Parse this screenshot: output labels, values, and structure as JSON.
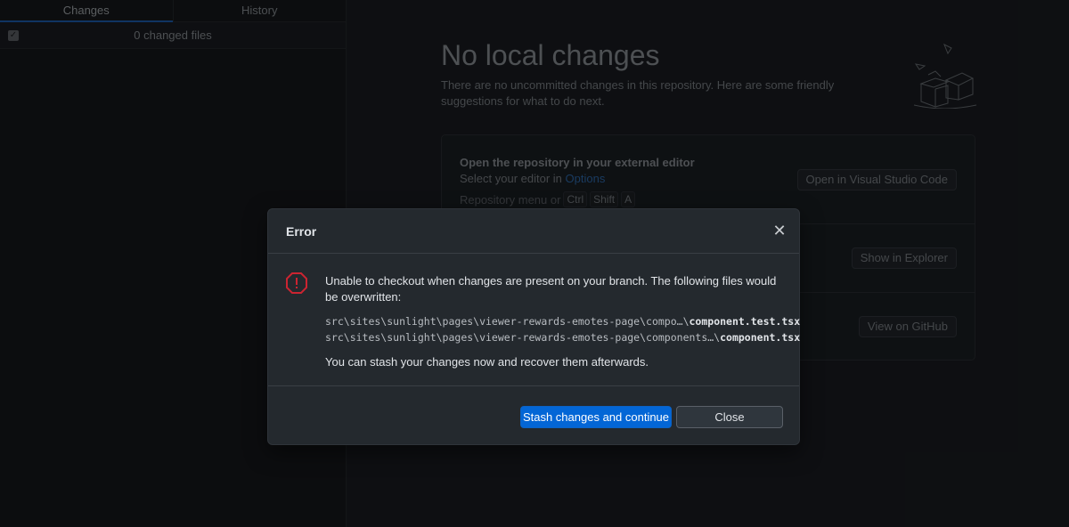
{
  "sidebar": {
    "tabs": [
      {
        "label": "Changes",
        "active": true
      },
      {
        "label": "History",
        "active": false
      }
    ],
    "changed_files_label": "0 changed files"
  },
  "main": {
    "title": "No local changes",
    "description": "There are no uncommitted changes in this repository. Here are some friendly suggestions for what to do next.",
    "suggestions": [
      {
        "title": "Open the repository in your external editor",
        "subtitle_prefix": "Select your editor in ",
        "subtitle_link": "Options",
        "shortcut_prefix": "Repository menu or",
        "keys": [
          "Ctrl",
          "Shift",
          "A"
        ],
        "button": "Open in Visual Studio Code"
      },
      {
        "button": "Show in Explorer"
      },
      {
        "button": "View on GitHub"
      }
    ]
  },
  "dialog": {
    "title": "Error",
    "message": "Unable to checkout when changes are present on your branch. The following files would be overwritten:",
    "files": [
      {
        "path": "src\\sites\\sunlight\\pages\\viewer-rewards-emotes-page\\compo…\\",
        "name": "component.test.tsx"
      },
      {
        "path": "src\\sites\\sunlight\\pages\\viewer-rewards-emotes-page\\components…\\",
        "name": "component.tsx"
      }
    ],
    "note": "You can stash your changes now and recover them afterwards.",
    "primary_button": "Stash changes and continue",
    "secondary_button": "Close",
    "close_glyph": "✕"
  },
  "colors": {
    "accent": "#0366d6",
    "error": "#cb2431",
    "dialog_bg": "#24292e"
  }
}
